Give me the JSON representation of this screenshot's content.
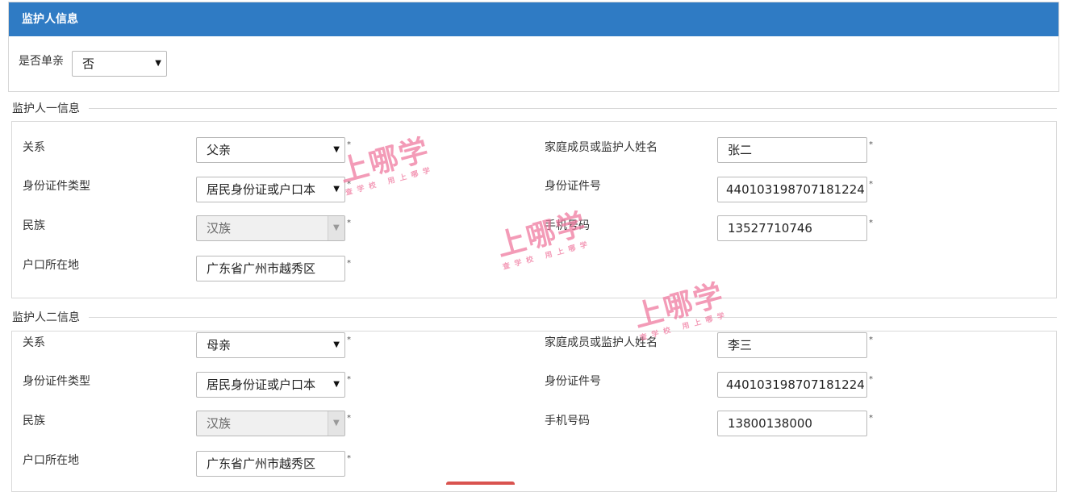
{
  "header": {
    "title": "监护人信息"
  },
  "single": {
    "label": "是否单亲",
    "value": "否"
  },
  "guardian1": {
    "title": "监护人一信息",
    "relation_label": "关系",
    "relation_value": "父亲",
    "id_type_label": "身份证件类型",
    "id_type_value": "居民身份证或户口本",
    "ethnic_label": "民族",
    "ethnic_value": "汉族",
    "hukou_label": "户口所在地",
    "hukou_value": "广东省广州市越秀区",
    "name_label": "家庭成员或监护人姓名",
    "name_value": "张二",
    "id_no_label": "身份证件号",
    "id_no_value": "440103198707181224",
    "phone_label": "手机号码",
    "phone_value": "13527710746"
  },
  "guardian2": {
    "title": "监护人二信息",
    "relation_label": "关系",
    "relation_value": "母亲",
    "id_type_label": "身份证件类型",
    "id_type_value": "居民身份证或户口本",
    "ethnic_label": "民族",
    "ethnic_value": "汉族",
    "hukou_label": "户口所在地",
    "hukou_value": "广东省广州市越秀区",
    "name_label": "家庭成员或监护人姓名",
    "name_value": "李三",
    "id_no_label": "身份证件号",
    "id_no_value": "440103198707181224",
    "phone_label": "手机号码",
    "phone_value": "13800138000"
  },
  "required_mark": "*",
  "icons": {
    "dropdown": "▼"
  },
  "watermark": {
    "big": "上哪学",
    "small": "查学校 用上哪学"
  }
}
